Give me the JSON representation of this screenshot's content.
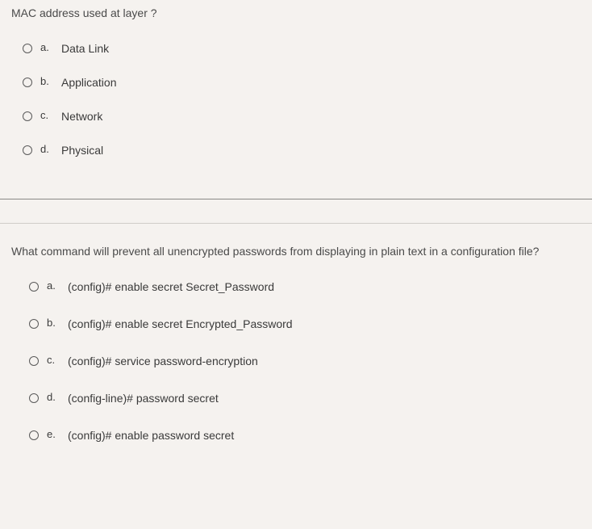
{
  "q1": {
    "text": "MAC address used at layer ?",
    "options": {
      "a": {
        "letter": "a.",
        "text": "Data Link"
      },
      "b": {
        "letter": "b.",
        "text": "Application"
      },
      "c": {
        "letter": "c.",
        "text": "Network"
      },
      "d": {
        "letter": "d.",
        "text": "Physical"
      }
    }
  },
  "q2": {
    "text": "What command will prevent all unencrypted passwords from displaying in plain text in a configuration file?",
    "options": {
      "a": {
        "letter": "a.",
        "text": "(config)# enable secret Secret_Password"
      },
      "b": {
        "letter": "b.",
        "text": "(config)# enable secret Encrypted_Password"
      },
      "c": {
        "letter": "c.",
        "text": "(config)# service password-encryption"
      },
      "d": {
        "letter": "d.",
        "text": "(config-line)# password secret"
      },
      "e": {
        "letter": "e.",
        "text": "(config)# enable password secret"
      }
    }
  }
}
